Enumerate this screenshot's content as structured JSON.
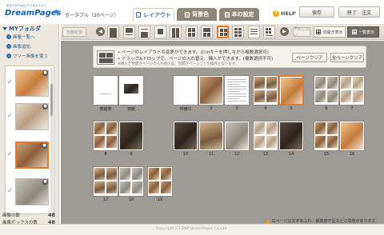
{
  "header": {
    "logo_tagline": "あなたのそばにデジタルフォト",
    "logo_brand": "DreamPages",
    "product": "ポータブル（20ページ）",
    "tabs": [
      {
        "label": "レイアウト",
        "active": true
      },
      {
        "label": "背景色",
        "active": false
      },
      {
        "label": "本の設定",
        "active": false
      }
    ],
    "help": "HELP",
    "save": "保存",
    "finish": "終了　注文"
  },
  "sidebar": {
    "title": "MYフォルダ",
    "items": [
      {
        "label": "画像一覧へ"
      },
      {
        "label": "画像追加"
      },
      {
        "label": "フリー画像を使う"
      }
    ],
    "thumbnails": [
      {
        "photo": "c-dog",
        "selected": false
      },
      {
        "photo": "c-cushion",
        "selected": false
      },
      {
        "photo": "c-cat1",
        "selected": true
      },
      {
        "photo": "c-grey",
        "selected": false
      }
    ],
    "image_count_label": "画像の数",
    "image_count": "48",
    "box_count_label": "画像ボックスの数",
    "box_count": "48"
  },
  "toolbar": {
    "auto_layout": "自動配置",
    "reserve": "予約しない",
    "spread_view": "見開き表示",
    "list_view": "一覧表示",
    "layouts": [
      {
        "name": "layout-full"
      },
      {
        "name": "layout-top"
      },
      {
        "name": "layout-bottom"
      },
      {
        "name": "layout-small"
      },
      {
        "name": "layout-two"
      },
      {
        "name": "layout-four"
      },
      {
        "name": "layout-three"
      },
      {
        "name": "layout-grid-selected"
      },
      {
        "name": "layout-six"
      },
      {
        "name": "layout-text"
      },
      {
        "name": "layout-six-text"
      }
    ]
  },
  "info": {
    "line1": "• ページのレイアウトの変更ができます。(Ctrlキーを押しながら複数選択可)",
    "line2": "• ドラッグ&ドロップで、ページの入れ替え、挿入ができます。(複数選択不可)",
    "line3": "※挿入と見開きページの入れ替えは、見開きページごとの操作となります。",
    "clear_page": "ページクリア",
    "clear_all": "全ページクリア"
  },
  "pages": [
    {
      "label": "表紙表",
      "kind": "cover"
    },
    {
      "label": "表紙",
      "kind": "cover2"
    },
    {
      "label": "中扉/1",
      "kind": "blank"
    },
    {
      "label": "2",
      "kind": "photo",
      "photo": "c-cat1"
    },
    {
      "label": "3",
      "kind": "text"
    },
    {
      "label": "4",
      "kind": "grid",
      "photo": "c-cat2"
    },
    {
      "label": "5",
      "kind": "photo",
      "photo": "c-dog",
      "selected": true
    },
    {
      "label": "6",
      "kind": "grid",
      "photo": "c-grey"
    },
    {
      "label": "7",
      "kind": "grid",
      "photo": "c-cushion"
    },
    {
      "label": "8",
      "kind": "grid",
      "photo": "c-cat1"
    },
    {
      "label": "9",
      "kind": "photo",
      "photo": "c-dark"
    },
    {
      "label": "10",
      "kind": "photo",
      "photo": "c-dark"
    },
    {
      "label": "11",
      "kind": "photo",
      "photo": "c-cat2"
    },
    {
      "label": "12",
      "kind": "photo",
      "photo": "c-grey"
    },
    {
      "label": "13",
      "kind": "grid",
      "photo": "c-cushion"
    },
    {
      "label": "14",
      "kind": "photo",
      "photo": "c-dark"
    },
    {
      "label": "15",
      "kind": "grid",
      "photo": "c-cat1"
    },
    {
      "label": "16",
      "kind": "photo",
      "photo": "c-dog"
    },
    {
      "label": "17",
      "kind": "grid",
      "photo": "c-cat2"
    },
    {
      "label": "18",
      "kind": "grid",
      "photo": "c-grey"
    },
    {
      "label": "19",
      "kind": "grid",
      "photo": "c-cat1"
    },
    {
      "label": "裏扉/20",
      "kind": "text"
    }
  ],
  "warning": "のページは文字あふれ、解像度不足などの問題があります。",
  "copyright": "Copyright (C) DNP DreamPages Co.,Ltd."
}
